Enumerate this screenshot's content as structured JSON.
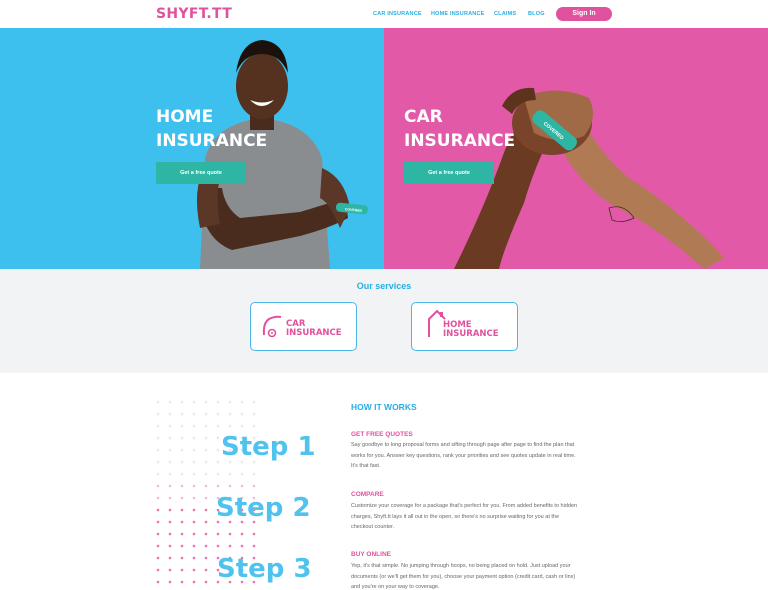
{
  "header": {
    "logo": "SHYFT.TT",
    "nav": [
      "CAR INSURANCE",
      "HOME INSURANCE",
      "CLAIMS",
      "BLOG"
    ],
    "signin_label": "Sign In"
  },
  "hero": {
    "home": {
      "line1": "HOME",
      "line2": "INSURANCE",
      "cta": "Get a free quote",
      "bandage_text": "COVERED"
    },
    "car": {
      "line1": "CAR",
      "line2": "INSURANCE",
      "cta": "Get a free quote",
      "bandage_text": "COVERED"
    }
  },
  "services": {
    "title": "Our services",
    "cards": [
      {
        "line1": "CAR",
        "line2": "INSURANCE",
        "icon": "car-icon"
      },
      {
        "line1": "HOME",
        "line2": "INSURANCE",
        "icon": "house-icon"
      }
    ]
  },
  "how_it_works": {
    "title": "HOW IT WORKS",
    "steps": [
      "Step 1",
      "Step 2",
      "Step 3"
    ],
    "sections": [
      {
        "title": "GET FREE QUOTES",
        "body": "Say goodbye to long proposal forms and sifting through page after page to find the plan that works for you. Answer key questions, rank your priorities and see quotes update in real time. It's that fast."
      },
      {
        "title": "COMPARE",
        "body": "Customize your coverage for a package that's perfect for you. From added benefits to hidden charges, Shyft.tt lays it all out in the open, so there's no surprise waiting for you at the checkout counter."
      },
      {
        "title": "BUY ONLINE",
        "body": "Yep, it's that simple. No jumping through hoops, no being placed on hold. Just upload your documents (or we'll get them for you), choose your payment option (credit card, cash or linx) and you're on your way to coverage."
      }
    ]
  },
  "colors": {
    "brand_pink": "#e0519e",
    "brand_blue": "#3ec0ef",
    "teal": "#2eb5a3"
  }
}
